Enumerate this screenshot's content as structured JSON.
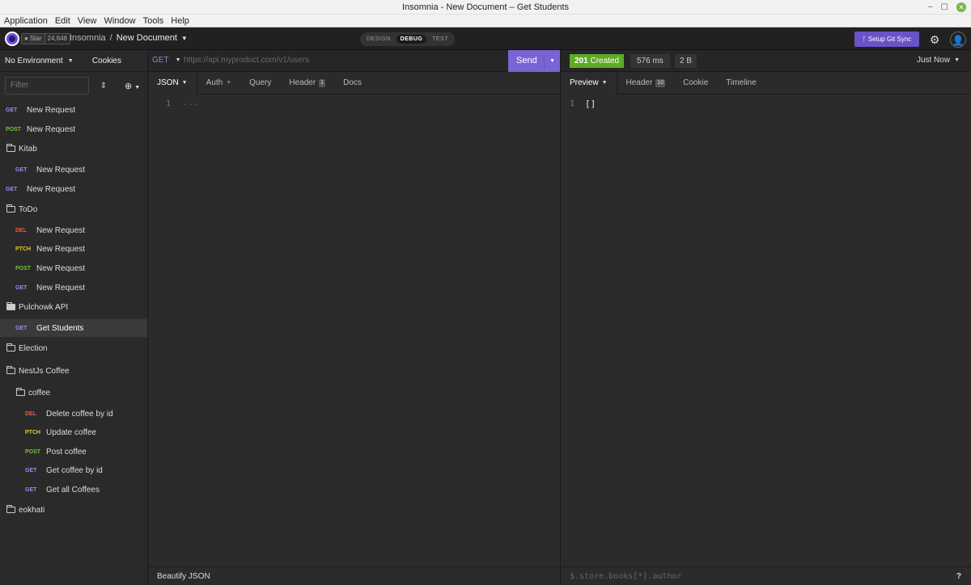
{
  "window": {
    "title": "Insomnia - New Document – Get Students",
    "controls": {
      "minimize": "–",
      "maximize": "▢",
      "close": "✕"
    }
  },
  "menubar": [
    "Application",
    "Edit",
    "View",
    "Window",
    "Tools",
    "Help"
  ],
  "header": {
    "star_label": "Star",
    "star_count": "24,848",
    "app_name": "Insomnia",
    "separator": "/",
    "document": "New Document",
    "modes": [
      "DESIGN",
      "DEBUG",
      "TEST"
    ],
    "active_mode": "DEBUG",
    "git_sync_label": "Setup Git Sync"
  },
  "sidebar": {
    "environment": "No Environment",
    "cookies_label": "Cookies",
    "filter_placeholder": "Filter",
    "items": [
      {
        "type": "request",
        "method": "GET",
        "label": "New Request",
        "depth": 0
      },
      {
        "type": "request",
        "method": "POST",
        "label": "New Request",
        "depth": 0
      },
      {
        "type": "folder",
        "label": "Kitab",
        "depth": 0,
        "open": false
      },
      {
        "type": "request",
        "method": "GET",
        "label": "New Request",
        "depth": 1
      },
      {
        "type": "request",
        "method": "GET",
        "label": "New Request",
        "depth": 0
      },
      {
        "type": "folder",
        "label": "ToDo",
        "depth": 0,
        "open": false
      },
      {
        "type": "request",
        "method": "DEL",
        "label": "New Request",
        "depth": 1
      },
      {
        "type": "request",
        "method": "PTCH",
        "label": "New Request",
        "depth": 1
      },
      {
        "type": "request",
        "method": "POST",
        "label": "New Request",
        "depth": 1
      },
      {
        "type": "request",
        "method": "GET",
        "label": "New Request",
        "depth": 1
      },
      {
        "type": "folder",
        "label": "Pulchowk API",
        "depth": 0,
        "open": true
      },
      {
        "type": "request",
        "method": "GET",
        "label": "Get Students",
        "depth": 1,
        "selected": true
      },
      {
        "type": "folder",
        "label": "Election",
        "depth": 0,
        "open": false
      },
      {
        "type": "folder",
        "label": "NestJs Coffee",
        "depth": 0,
        "open": false
      },
      {
        "type": "folder",
        "label": "coffee",
        "depth": 1,
        "open": false
      },
      {
        "type": "request",
        "method": "DEL",
        "label": "Delete coffee by id",
        "depth": 2
      },
      {
        "type": "request",
        "method": "PTCH",
        "label": "Update coffee",
        "depth": 2
      },
      {
        "type": "request",
        "method": "POST",
        "label": "Post coffee",
        "depth": 2
      },
      {
        "type": "request",
        "method": "GET",
        "label": "Get coffee by id",
        "depth": 2
      },
      {
        "type": "request",
        "method": "GET",
        "label": "Get all Coffees",
        "depth": 2
      },
      {
        "type": "folder",
        "label": "eokhati",
        "depth": 0,
        "open": false
      }
    ]
  },
  "request": {
    "method": "GET",
    "url_placeholder": "https://api.myproduct.com/v1/users",
    "send_label": "Send",
    "tabs": [
      {
        "label": "JSON",
        "dropdown": true,
        "active": true
      },
      {
        "label": "Auth",
        "dropdown": true
      },
      {
        "label": "Query"
      },
      {
        "label": "Header",
        "count": "1"
      },
      {
        "label": "Docs"
      }
    ],
    "line_number": "1",
    "body_placeholder": "...",
    "beautify_label": "Beautify JSON"
  },
  "response": {
    "status_code": "201",
    "status_text": "Created",
    "time": "576 ms",
    "size": "2 B",
    "time_select": "Just Now",
    "tabs": [
      {
        "label": "Preview",
        "dropdown": true,
        "active": true
      },
      {
        "label": "Header",
        "count": "10"
      },
      {
        "label": "Cookie"
      },
      {
        "label": "Timeline"
      }
    ],
    "line_number": "1",
    "body": "[]",
    "filter_placeholder": "$.store.books[*].author",
    "help_glyph": "?"
  },
  "colors": {
    "accent": "#7a64d4",
    "status_success": "#5eab25",
    "get": "#9a8ef0",
    "post": "#76c234",
    "delete": "#ee5c3f",
    "patch": "#e5c82b"
  }
}
